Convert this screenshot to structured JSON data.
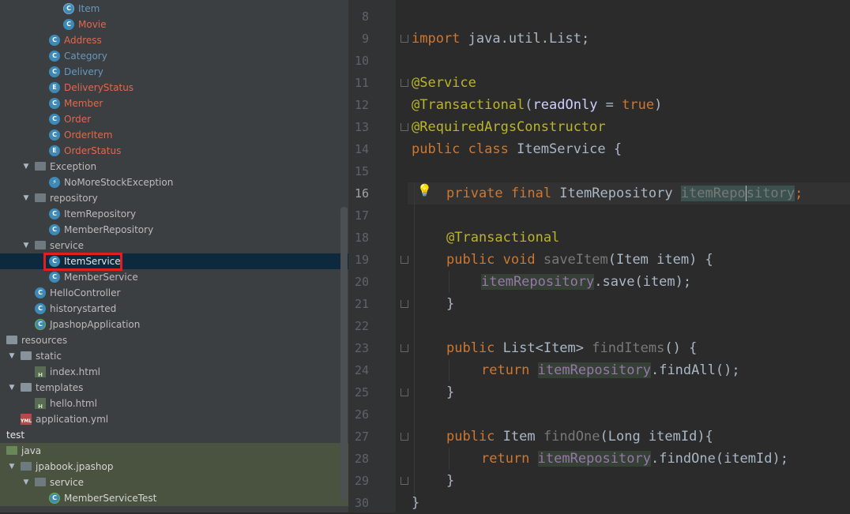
{
  "tree": {
    "items": [
      {
        "label": "Item",
        "color": "blue",
        "indent": 80,
        "icon": "class-icon",
        "arrow": false
      },
      {
        "label": "Movie",
        "color": "red",
        "indent": 80,
        "icon": "class-icon",
        "arrow": false
      },
      {
        "label": "Address",
        "color": "red",
        "indent": 62,
        "icon": "class-icon",
        "arrow": false
      },
      {
        "label": "Category",
        "color": "blue",
        "indent": 62,
        "icon": "class-icon",
        "arrow": false
      },
      {
        "label": "Delivery",
        "color": "blue",
        "indent": 62,
        "icon": "class-icon",
        "arrow": false
      },
      {
        "label": "DeliveryStatus",
        "color": "red",
        "indent": 62,
        "icon": "enum-icon",
        "arrow": false
      },
      {
        "label": "Member",
        "color": "red",
        "indent": 62,
        "icon": "class-icon",
        "arrow": false
      },
      {
        "label": "Order",
        "color": "red",
        "indent": 62,
        "icon": "class-icon",
        "arrow": false
      },
      {
        "label": "OrderItem",
        "color": "red",
        "indent": 62,
        "icon": "class-icon",
        "arrow": false
      },
      {
        "label": "OrderStatus",
        "color": "red",
        "indent": 62,
        "icon": "enum-icon",
        "arrow": false
      },
      {
        "label": "Exception",
        "color": "normal",
        "indent": 44,
        "icon": "package-icon",
        "arrow": true
      },
      {
        "label": "NoMoreStockException",
        "color": "normal",
        "indent": 62,
        "icon": "exception-class-icon",
        "arrow": false
      },
      {
        "label": "repository",
        "color": "normal",
        "indent": 44,
        "icon": "package-icon",
        "arrow": true
      },
      {
        "label": "ItemRepository",
        "color": "normal",
        "indent": 62,
        "icon": "class-icon",
        "arrow": false
      },
      {
        "label": "MemberRepository",
        "color": "normal",
        "indent": 62,
        "icon": "class-icon",
        "arrow": false
      },
      {
        "label": "service",
        "color": "normal",
        "indent": 44,
        "icon": "package-icon",
        "arrow": true
      },
      {
        "label": "ItemService",
        "color": "white",
        "indent": 62,
        "icon": "class-icon",
        "arrow": false,
        "selected": true
      },
      {
        "label": "MemberService",
        "color": "normal",
        "indent": 62,
        "icon": "class-icon",
        "arrow": false
      },
      {
        "label": "HelloController",
        "color": "normal",
        "indent": 44,
        "icon": "class-icon",
        "arrow": false
      },
      {
        "label": "historystarted",
        "color": "normal",
        "indent": 44,
        "icon": "class-icon",
        "arrow": false
      },
      {
        "label": "JpashopApplication",
        "color": "normal",
        "indent": 44,
        "icon": "spring-boot-class-icon",
        "arrow": false
      },
      {
        "label": "resources",
        "color": "normal",
        "indent": 8,
        "icon": "resources-folder-icon",
        "arrow": false
      },
      {
        "label": "static",
        "color": "normal",
        "indent": 26,
        "icon": "folder-icon",
        "arrow": true
      },
      {
        "label": "index.html",
        "color": "normal",
        "indent": 44,
        "icon": "html-file-icon",
        "arrow": false
      },
      {
        "label": "templates",
        "color": "normal",
        "indent": 26,
        "icon": "folder-icon",
        "arrow": true
      },
      {
        "label": "hello.html",
        "color": "normal",
        "indent": 44,
        "icon": "html-file-icon",
        "arrow": false
      },
      {
        "label": "application.yml",
        "color": "normal",
        "indent": 26,
        "icon": "yml-file-icon",
        "arrow": false
      },
      {
        "label": "test",
        "color": "white",
        "indent": 8,
        "icon": "none",
        "arrow": false
      },
      {
        "label": "java",
        "color": "test",
        "indent": 8,
        "icon": "test-folder-icon",
        "arrow": false,
        "testbg": true
      },
      {
        "label": "jpabook.jpashop",
        "color": "test",
        "indent": 26,
        "icon": "package-icon",
        "arrow": true,
        "testbg": true
      },
      {
        "label": "service",
        "color": "test",
        "indent": 44,
        "icon": "package-icon",
        "arrow": true,
        "testbg": true
      },
      {
        "label": "MemberServiceTest",
        "color": "test",
        "indent": 62,
        "icon": "test-class-icon",
        "arrow": false,
        "testbg": true
      }
    ]
  },
  "editor": {
    "line_numbers": [
      "8",
      "9",
      "10",
      "11",
      "12",
      "13",
      "14",
      "15",
      "16",
      "17",
      "18",
      "19",
      "20",
      "21",
      "22",
      "23",
      "24",
      "25",
      "26",
      "27",
      "28",
      "29",
      "30"
    ],
    "current_line": "16",
    "code": {
      "l9_import": "import",
      "l9_rest": " java.util.List;",
      "l11": "@Service",
      "l12_ann": "@Transactional",
      "l12_paren_open": "(",
      "l12_param": "readOnly",
      "l12_eq": " = ",
      "l12_val": "true",
      "l12_paren_close": ")",
      "l13": "@RequiredArgsConstructor",
      "l14_kw": "public class",
      "l14_name": " ItemService {",
      "l16_kw": "private final",
      "l16_type": " ItemRepository ",
      "l16_field_a": "itemRepo",
      "l16_field_b": "sitory",
      "l16_semi": ";",
      "l18": "@Transactional",
      "l19_kw": "public void",
      "l19_fn": "saveItem",
      "l19_rest": "(Item item) {",
      "l20_field": "itemRepository",
      "l20_rest": ".save(item);",
      "l21": "}",
      "l23_kw": "public",
      "l23_type": " List<Item> ",
      "l23_fn": "findItems",
      "l23_rest": "() {",
      "l24_kw": "return",
      "l24_field": "itemRepository",
      "l24_rest": ".findAll();",
      "l25": "}",
      "l27_kw": "public",
      "l27_type": " Item ",
      "l27_fn": "findOne",
      "l27_rest": "(Long itemId){",
      "l28_kw": "return",
      "l28_field": "itemRepository",
      "l28_rest": ".findOne(itemId);",
      "l29": "}",
      "l30": "}"
    }
  }
}
